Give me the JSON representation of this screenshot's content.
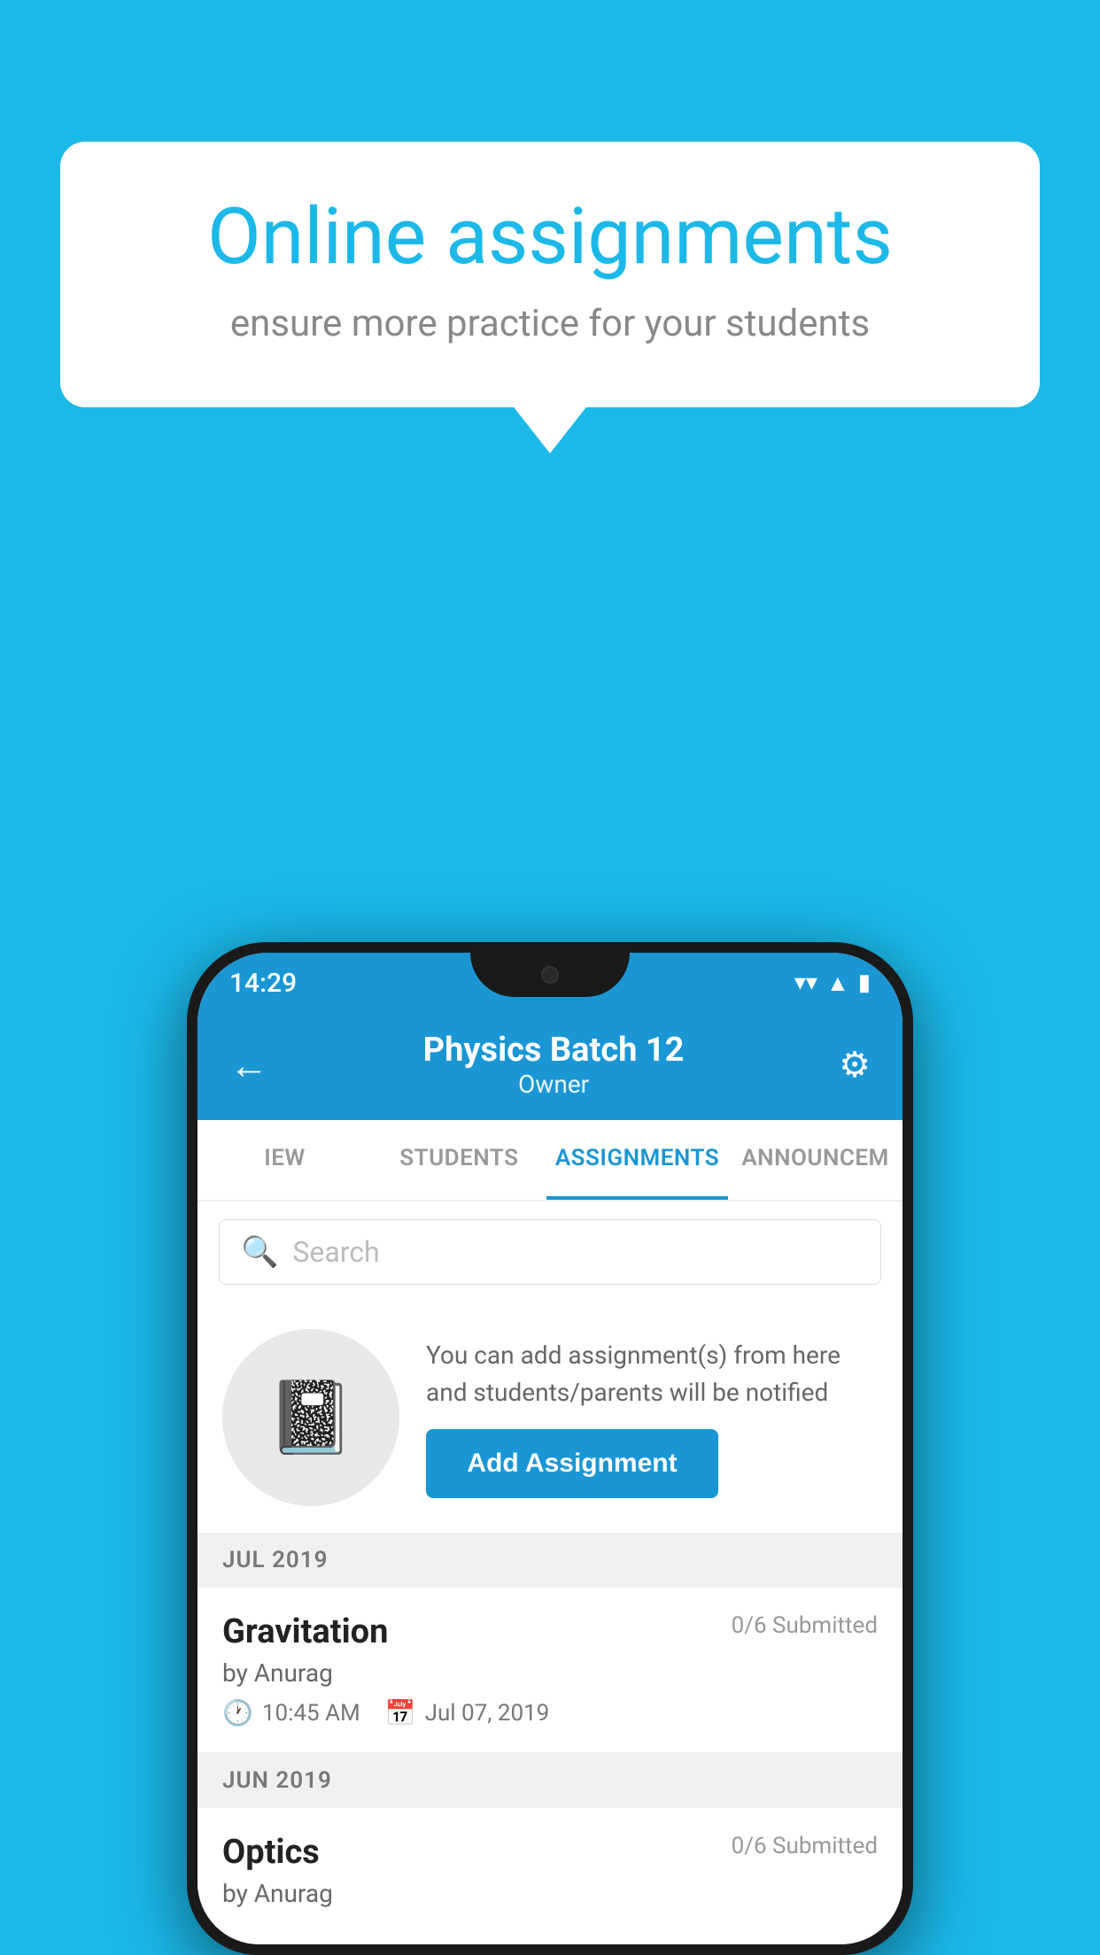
{
  "background": {
    "color": "#1bb8e8"
  },
  "speech_bubble": {
    "title": "Online assignments",
    "subtitle": "ensure more practice for your students"
  },
  "phone": {
    "status_bar": {
      "time": "14:29",
      "icons": [
        "wifi",
        "signal",
        "battery"
      ]
    },
    "header": {
      "title": "Physics Batch 12",
      "subtitle": "Owner",
      "back_label": "←",
      "settings_label": "⚙"
    },
    "tabs": [
      {
        "label": "IEW",
        "active": false
      },
      {
        "label": "STUDENTS",
        "active": false
      },
      {
        "label": "ASSIGNMENTS",
        "active": true
      },
      {
        "label": "ANNOUNCEM",
        "active": false
      }
    ],
    "search": {
      "placeholder": "Search"
    },
    "info_block": {
      "text": "You can add assignment(s) from here and students/parents will be notified",
      "button_label": "Add Assignment"
    },
    "sections": [
      {
        "label": "JUL 2019",
        "assignments": [
          {
            "title": "Gravitation",
            "submitted": "0/6 Submitted",
            "author": "by Anurag",
            "time": "10:45 AM",
            "date": "Jul 07, 2019"
          }
        ]
      },
      {
        "label": "JUN 2019",
        "assignments": [
          {
            "title": "Optics",
            "submitted": "0/6 Submitted",
            "author": "by Anurag",
            "time": "",
            "date": ""
          }
        ]
      }
    ]
  }
}
